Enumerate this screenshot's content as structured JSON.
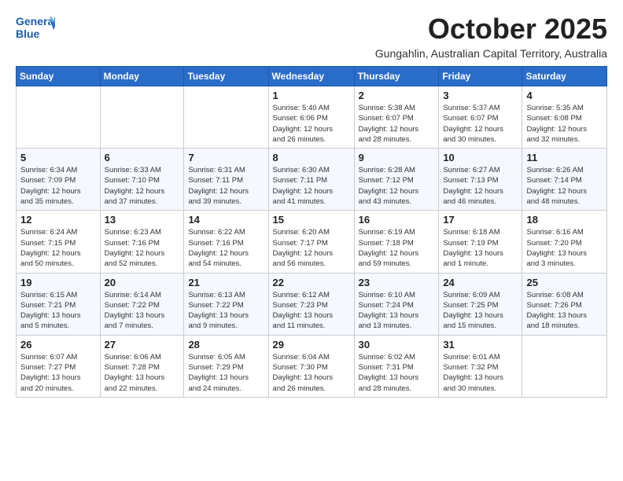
{
  "logo": {
    "line1": "General",
    "line2": "Blue"
  },
  "header": {
    "month": "October 2025",
    "subtitle": "Gungahlin, Australian Capital Territory, Australia"
  },
  "weekdays": [
    "Sunday",
    "Monday",
    "Tuesday",
    "Wednesday",
    "Thursday",
    "Friday",
    "Saturday"
  ],
  "weeks": [
    [
      {
        "day": "",
        "info": ""
      },
      {
        "day": "",
        "info": ""
      },
      {
        "day": "",
        "info": ""
      },
      {
        "day": "1",
        "info": "Sunrise: 5:40 AM\nSunset: 6:06 PM\nDaylight: 12 hours\nand 26 minutes."
      },
      {
        "day": "2",
        "info": "Sunrise: 5:38 AM\nSunset: 6:07 PM\nDaylight: 12 hours\nand 28 minutes."
      },
      {
        "day": "3",
        "info": "Sunrise: 5:37 AM\nSunset: 6:07 PM\nDaylight: 12 hours\nand 30 minutes."
      },
      {
        "day": "4",
        "info": "Sunrise: 5:35 AM\nSunset: 6:08 PM\nDaylight: 12 hours\nand 32 minutes."
      }
    ],
    [
      {
        "day": "5",
        "info": "Sunrise: 6:34 AM\nSunset: 7:09 PM\nDaylight: 12 hours\nand 35 minutes."
      },
      {
        "day": "6",
        "info": "Sunrise: 6:33 AM\nSunset: 7:10 PM\nDaylight: 12 hours\nand 37 minutes."
      },
      {
        "day": "7",
        "info": "Sunrise: 6:31 AM\nSunset: 7:11 PM\nDaylight: 12 hours\nand 39 minutes."
      },
      {
        "day": "8",
        "info": "Sunrise: 6:30 AM\nSunset: 7:11 PM\nDaylight: 12 hours\nand 41 minutes."
      },
      {
        "day": "9",
        "info": "Sunrise: 6:28 AM\nSunset: 7:12 PM\nDaylight: 12 hours\nand 43 minutes."
      },
      {
        "day": "10",
        "info": "Sunrise: 6:27 AM\nSunset: 7:13 PM\nDaylight: 12 hours\nand 46 minutes."
      },
      {
        "day": "11",
        "info": "Sunrise: 6:26 AM\nSunset: 7:14 PM\nDaylight: 12 hours\nand 48 minutes."
      }
    ],
    [
      {
        "day": "12",
        "info": "Sunrise: 6:24 AM\nSunset: 7:15 PM\nDaylight: 12 hours\nand 50 minutes."
      },
      {
        "day": "13",
        "info": "Sunrise: 6:23 AM\nSunset: 7:16 PM\nDaylight: 12 hours\nand 52 minutes."
      },
      {
        "day": "14",
        "info": "Sunrise: 6:22 AM\nSunset: 7:16 PM\nDaylight: 12 hours\nand 54 minutes."
      },
      {
        "day": "15",
        "info": "Sunrise: 6:20 AM\nSunset: 7:17 PM\nDaylight: 12 hours\nand 56 minutes."
      },
      {
        "day": "16",
        "info": "Sunrise: 6:19 AM\nSunset: 7:18 PM\nDaylight: 12 hours\nand 59 minutes."
      },
      {
        "day": "17",
        "info": "Sunrise: 6:18 AM\nSunset: 7:19 PM\nDaylight: 13 hours\nand 1 minute."
      },
      {
        "day": "18",
        "info": "Sunrise: 6:16 AM\nSunset: 7:20 PM\nDaylight: 13 hours\nand 3 minutes."
      }
    ],
    [
      {
        "day": "19",
        "info": "Sunrise: 6:15 AM\nSunset: 7:21 PM\nDaylight: 13 hours\nand 5 minutes."
      },
      {
        "day": "20",
        "info": "Sunrise: 6:14 AM\nSunset: 7:22 PM\nDaylight: 13 hours\nand 7 minutes."
      },
      {
        "day": "21",
        "info": "Sunrise: 6:13 AM\nSunset: 7:22 PM\nDaylight: 13 hours\nand 9 minutes."
      },
      {
        "day": "22",
        "info": "Sunrise: 6:12 AM\nSunset: 7:23 PM\nDaylight: 13 hours\nand 11 minutes."
      },
      {
        "day": "23",
        "info": "Sunrise: 6:10 AM\nSunset: 7:24 PM\nDaylight: 13 hours\nand 13 minutes."
      },
      {
        "day": "24",
        "info": "Sunrise: 6:09 AM\nSunset: 7:25 PM\nDaylight: 13 hours\nand 15 minutes."
      },
      {
        "day": "25",
        "info": "Sunrise: 6:08 AM\nSunset: 7:26 PM\nDaylight: 13 hours\nand 18 minutes."
      }
    ],
    [
      {
        "day": "26",
        "info": "Sunrise: 6:07 AM\nSunset: 7:27 PM\nDaylight: 13 hours\nand 20 minutes."
      },
      {
        "day": "27",
        "info": "Sunrise: 6:06 AM\nSunset: 7:28 PM\nDaylight: 13 hours\nand 22 minutes."
      },
      {
        "day": "28",
        "info": "Sunrise: 6:05 AM\nSunset: 7:29 PM\nDaylight: 13 hours\nand 24 minutes."
      },
      {
        "day": "29",
        "info": "Sunrise: 6:04 AM\nSunset: 7:30 PM\nDaylight: 13 hours\nand 26 minutes."
      },
      {
        "day": "30",
        "info": "Sunrise: 6:02 AM\nSunset: 7:31 PM\nDaylight: 13 hours\nand 28 minutes."
      },
      {
        "day": "31",
        "info": "Sunrise: 6:01 AM\nSunset: 7:32 PM\nDaylight: 13 hours\nand 30 minutes."
      },
      {
        "day": "",
        "info": ""
      }
    ]
  ]
}
